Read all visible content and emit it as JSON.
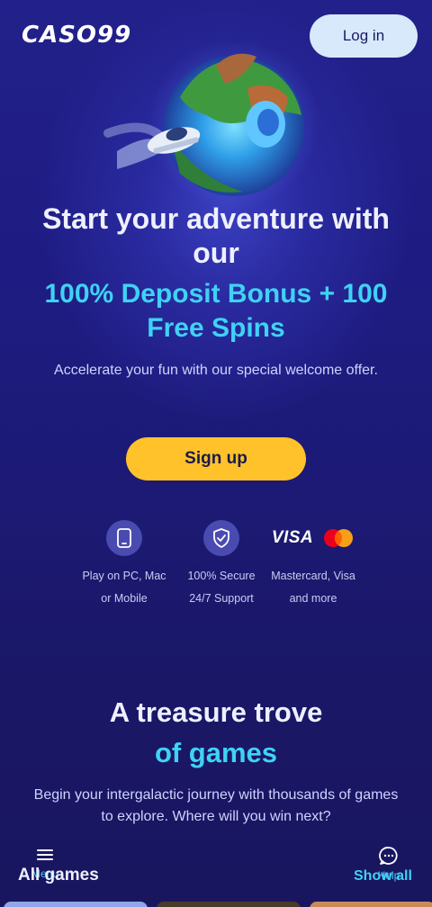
{
  "header": {
    "logo_text": "CASO99",
    "login_label": "Log in"
  },
  "hero": {
    "title": "Start your adventure with our",
    "bonus": "100% Deposit Bonus + 100 Free Spins",
    "subtitle": "Accelerate your fun with our special welcome offer.",
    "signup_label": "Sign up"
  },
  "features": [
    {
      "icon": "mobile-icon",
      "text": "Play on PC, Mac or Mobile"
    },
    {
      "icon": "shield-check-icon",
      "text": "100% Secure 24/7 Support"
    },
    {
      "icon": "visa-mastercard-logos",
      "text": "Mastercard, Visa and more",
      "visa_text": "VISA"
    }
  ],
  "games_section": {
    "title_line1": "A treasure trove",
    "title_line2": "of games",
    "subtitle": "Begin your intergalactic journey with thousands of games to explore. Where will you win next?",
    "all_games_label": "All games",
    "show_all_label": "Show all"
  },
  "bottom_nav": {
    "menu_label": "Menu",
    "help_label": "Help"
  },
  "colors": {
    "accent_cyan": "#3fd2f4",
    "signup_yellow": "#ffc22a",
    "login_bg": "#d7e9fb"
  }
}
